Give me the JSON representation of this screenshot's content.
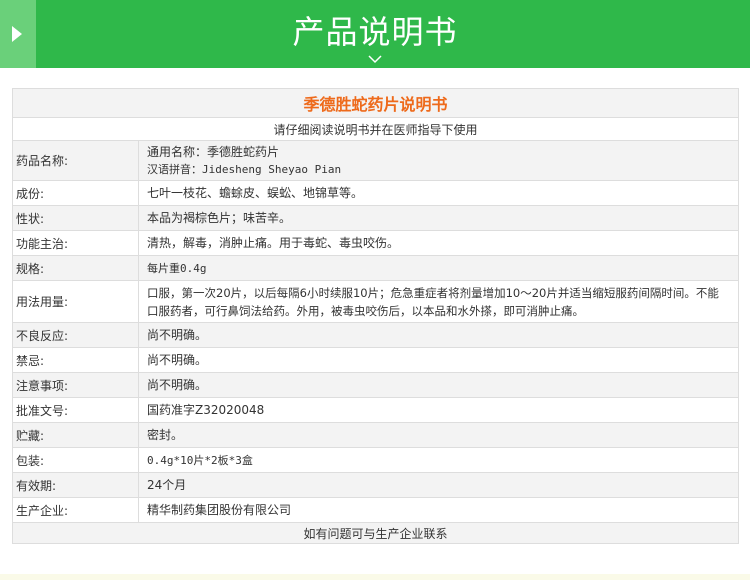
{
  "header": {
    "title": "产品说明书"
  },
  "doc": {
    "title": "季德胜蛇药片说明书",
    "subtitle": "请仔细阅读说明书并在医师指导下使用",
    "footer": "如有问题可与生产企业联系",
    "rows": [
      {
        "label": "药品名称:",
        "lines": [
          "通用名称：季德胜蛇药片",
          "汉语拼音：Jidesheng Sheyao Pian"
        ]
      },
      {
        "label": "成份:",
        "lines": [
          "七叶一枝花、蟾蜍皮、蜈蚣、地锦草等。"
        ]
      },
      {
        "label": "性状:",
        "lines": [
          "本品为褐棕色片；味苦辛。"
        ]
      },
      {
        "label": "功能主治:",
        "lines": [
          "清热，解毒，消肿止痛。用于毒蛇、毒虫咬伤。"
        ]
      },
      {
        "label": "规格:",
        "lines": [
          "每片重0.4g"
        ]
      },
      {
        "label": "用法用量:",
        "lines": [
          "口服，第一次20片，以后每隔6小时续服10片；危急重症者将剂量增加10～20片并适当缩短服药间隔时间。不能口服药者，可行鼻饲法给药。外用，被毒虫咬伤后，以本品和水外搽，即可消肿止痛。"
        ]
      },
      {
        "label": "不良反应:",
        "lines": [
          "尚不明确。"
        ]
      },
      {
        "label": "禁忌:",
        "lines": [
          "尚不明确。"
        ]
      },
      {
        "label": "注意事项:",
        "lines": [
          "尚不明确。"
        ]
      },
      {
        "label": "批准文号:",
        "lines": [
          "国药准字Z32020048"
        ]
      },
      {
        "label": "贮藏:",
        "lines": [
          "密封。"
        ]
      },
      {
        "label": "包装:",
        "lines": [
          "0.4g*10片*2板*3盒"
        ]
      },
      {
        "label": "有效期:",
        "lines": [
          "24个月"
        ]
      },
      {
        "label": "生产企业:",
        "lines": [
          "精华制药集团股份有限公司"
        ]
      }
    ]
  },
  "colors": {
    "header_green": "#2fb84a",
    "title_orange": "#ee6a1b"
  }
}
